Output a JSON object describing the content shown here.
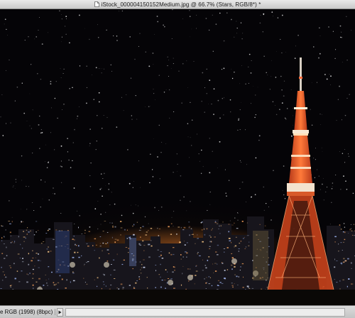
{
  "window": {
    "title": "iStock_000004150152Medium.jpg @ 66.7% (Stars, RGB/8*) *",
    "document_icon": "document-icon"
  },
  "canvas": {
    "image_subject": "night-city-skyline-with-tower-and-stars",
    "tower_color": "#e8552a",
    "sky_color": "#050407"
  },
  "statusbar": {
    "profile_text": "e RGB (1998) (8bpc)",
    "menu_arrow_icon": "triangle-right-icon"
  }
}
